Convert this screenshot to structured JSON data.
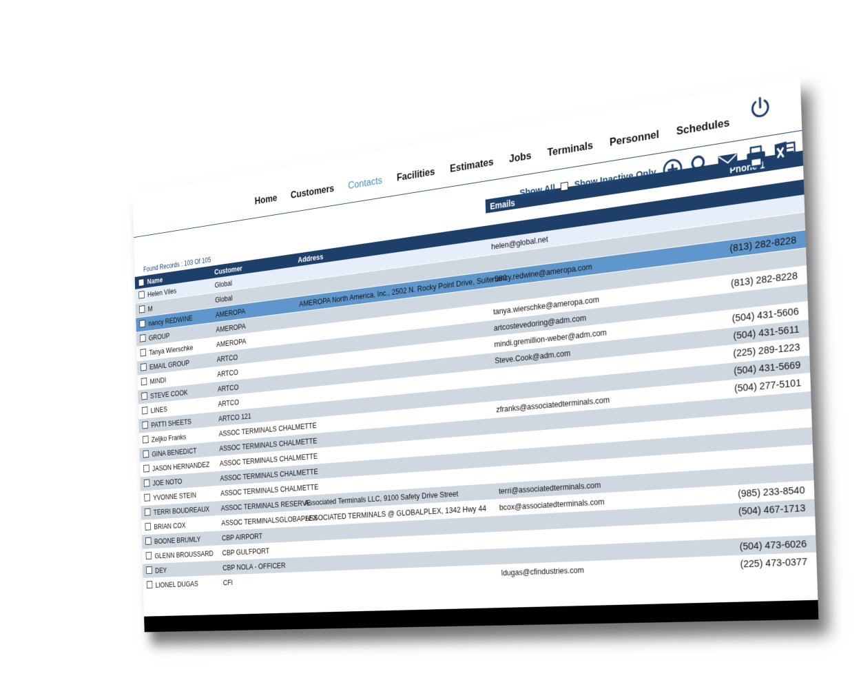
{
  "nav": {
    "items": [
      {
        "label": "Home",
        "active": false
      },
      {
        "label": "Customers",
        "active": false
      },
      {
        "label": "Contacts",
        "active": true
      },
      {
        "label": "Facilities",
        "active": false
      },
      {
        "label": "Estimates",
        "active": false
      },
      {
        "label": "Jobs",
        "active": false
      },
      {
        "label": "Terminals",
        "active": false
      },
      {
        "label": "Personnel",
        "active": false
      },
      {
        "label": "Schedules",
        "active": false
      }
    ],
    "power_icon": "power-icon"
  },
  "toolbar": {
    "show_all": "Show All",
    "show_inactive": "Show Inactive Only",
    "icons": [
      "add-icon",
      "search-icon",
      "mail-icon",
      "print-icon",
      "excel-icon"
    ]
  },
  "found_records": "Found Records : 103 Of 105",
  "columns": {
    "name": "Name",
    "customer": "Customer",
    "address": "Address",
    "emails": "Emails",
    "phone1": "Phone 1"
  },
  "rows": [
    {
      "name": "Helen Viles",
      "customer": "Global",
      "address": "",
      "email": "helen@global.net",
      "phone": ""
    },
    {
      "name": "M",
      "customer": "Global",
      "address": "",
      "email": "",
      "phone": ""
    },
    {
      "name": "nancy REDWINE",
      "customer": "AMEROPA",
      "address": "AMEROPA North America, Inc., 2502 N. Rocky Point Drive,  Suite 580",
      "email": "nancy.redwine@ameropa.com",
      "phone": "(813) 282-8228"
    },
    {
      "name": " GROUP",
      "customer": "AMEROPA",
      "address": "",
      "email": "",
      "phone": ""
    },
    {
      "name": "Tanya Wierschke",
      "customer": "AMEROPA",
      "address": "",
      "email": "tanya.wierschke@ameropa.com",
      "phone": "(813) 282-8228"
    },
    {
      "name": "EMAIL GROUP",
      "customer": "ARTCO",
      "address": "",
      "email": "artcostevedoring@adm.com",
      "phone": ""
    },
    {
      "name": "MINDI",
      "customer": "ARTCO",
      "address": "",
      "email": "mindi.gremillion-weber@adm.com",
      "phone": "(504) 431-5606"
    },
    {
      "name": "STEVE COOK",
      "customer": "ARTCO",
      "address": "",
      "email": "Steve.Cook@adm.com",
      "phone": "(504) 431-5611"
    },
    {
      "name": " LINES",
      "customer": "ARTCO",
      "address": "",
      "email": "",
      "phone": "(225) 289-1223"
    },
    {
      "name": "PATTI SHEETS",
      "customer": "ARTCO 121",
      "address": "",
      "email": "",
      "phone": "(504) 431-5669"
    },
    {
      "name": "Zeljko Franks",
      "customer": "ASSOC TERMINALS CHALMETTE",
      "address": "",
      "email": "zfranks@associatedterminals.com",
      "phone": "(504) 277-5101"
    },
    {
      "name": "GINA BENEDICT",
      "customer": "ASSOC TERMINALS CHALMETTE",
      "address": "",
      "email": "",
      "phone": ""
    },
    {
      "name": "JASON HERNANDEZ",
      "customer": "ASSOC TERMINALS CHALMETTE",
      "address": "",
      "email": "",
      "phone": ""
    },
    {
      "name": "JOE NOTO",
      "customer": "ASSOC TERMINALS CHALMETTE",
      "address": "",
      "email": "",
      "phone": ""
    },
    {
      "name": "YVONNE STEIN",
      "customer": "ASSOC TERMINALS CHALMETTE",
      "address": "",
      "email": "",
      "phone": ""
    },
    {
      "name": "TERRI BOUDREAUX",
      "customer": "ASSOC TERMINALS RESERVE",
      "address": "Associated Terminals LLC, 9100 Safety Drive Street",
      "email": "terri@associatedterminals.com",
      "phone": ""
    },
    {
      "name": "BRIAN COX",
      "customer": "ASSOC TERMINALSGLOBAPLEX",
      "address": "ASSOCIATED TERMINALS @ GLOBALPLEX, 1342 Hwy 44",
      "email": "bcox@associatedterminals.com",
      "phone": "(985) 233-8540"
    },
    {
      "name": "BOONE      BRUMLY",
      "customer": "CBP AIRPORT",
      "address": "",
      "email": "",
      "phone": "(504) 467-1713"
    },
    {
      "name": "GLENN BROUSSARD",
      "customer": "CBP GULFPORT",
      "address": "",
      "email": "",
      "phone": ""
    },
    {
      "name": " DEY",
      "customer": "CBP NOLA - OFFICER",
      "address": "",
      "email": "",
      "phone": "(504) 473-6026"
    },
    {
      "name": "LIONEL DUGAS",
      "customer": "CFI",
      "address": "",
      "email": "ldugas@cfindustries.com",
      "phone": "(225) 473-0377"
    }
  ],
  "colors": {
    "header_bg": "#1d3f6a",
    "active_nav": "#3d8fc6",
    "selected_row": "#5f97cc",
    "alt_row": "#cfd7e1"
  }
}
